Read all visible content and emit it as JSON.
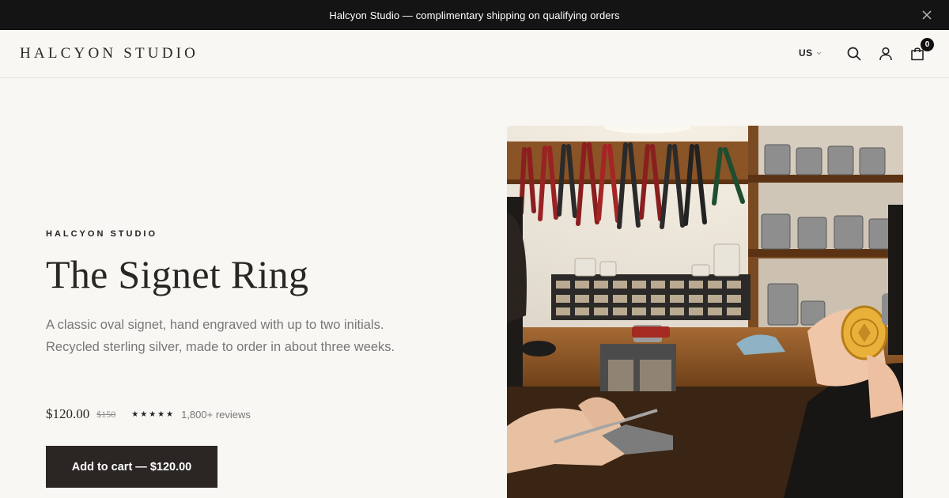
{
  "announcement": {
    "text": "Halcyon Studio — complimentary shipping on qualifying orders",
    "close_icon": "close-icon"
  },
  "header": {
    "logo": "HALCYON STUDIO",
    "locale": "US",
    "icons": [
      "search-icon",
      "account-icon",
      "cart-icon"
    ],
    "cart_count": "0"
  },
  "product": {
    "eyebrow": "HALCYON STUDIO",
    "title": "The Signet Ring",
    "description": "A classic oval signet, hand engraved with up to two initials. Recycled sterling silver, made to order in about three weeks.",
    "price": "$120.00",
    "compare_price": "$150",
    "rating_stars": 5,
    "reviews": "1,800+ reviews",
    "cta": "Add to cart — $120.00"
  },
  "colors": {
    "announcement_bg": "#141414",
    "page_bg": "#f9f7f3",
    "button_bg": "#2b2623",
    "text_muted": "#777777"
  }
}
